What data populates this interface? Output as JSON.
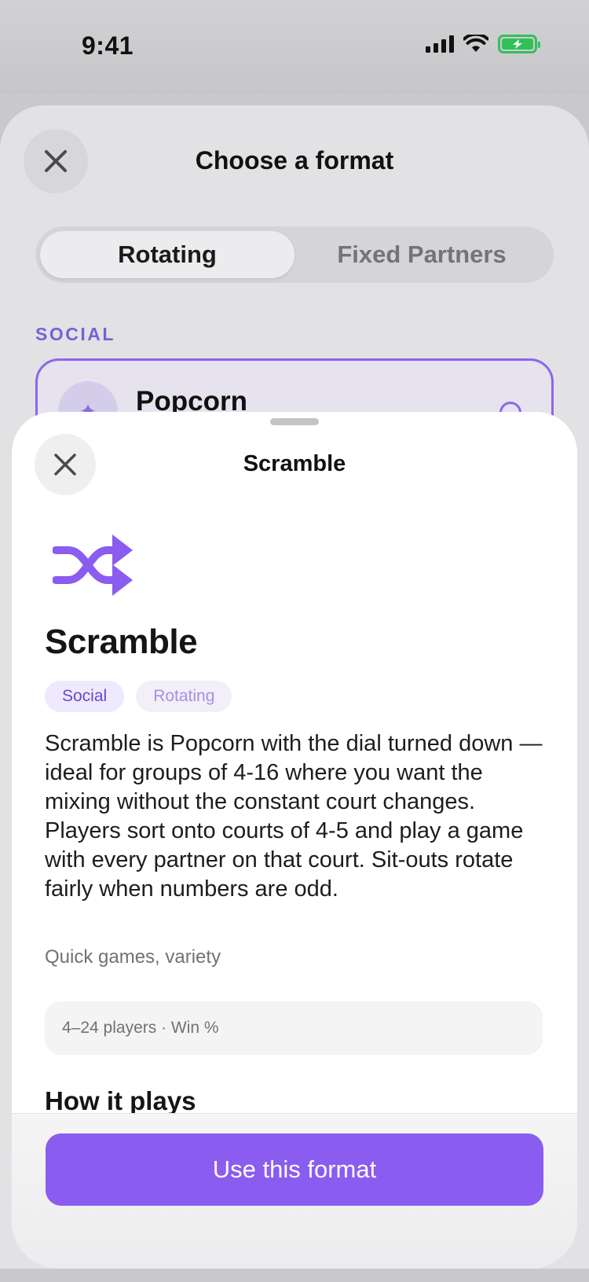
{
  "status": {
    "time": "9:41",
    "icons": [
      "signal-icon",
      "wifi-icon",
      "battery-charging-icon"
    ]
  },
  "background_sheet": {
    "title": "Choose a format",
    "tabs": [
      {
        "label": "Rotating",
        "active": true
      },
      {
        "label": "Fixed Partners",
        "active": false
      }
    ],
    "section_label": "SOCIAL",
    "card": {
      "title": "Popcorn"
    }
  },
  "sheet": {
    "title": "Scramble",
    "heading": "Scramble",
    "tags": [
      "Social",
      "Rotating"
    ],
    "description": "Scramble is Popcorn with the dial turned down — ideal for groups of 4-16 where you want the mixing without the constant court changes. Players sort onto courts of 4-5 and play a game with every partner on that court. Sit-outs rotate fairly when numbers are odd.",
    "best_for": "Quick games, variety",
    "info": "4–24 players · Win %",
    "how_it_plays_title": "How it plays",
    "cta_label": "Use this format"
  },
  "colors": {
    "accent": "#8b5cf0",
    "tag_social_bg": "#efe9fd",
    "battery": "#31c15a"
  }
}
